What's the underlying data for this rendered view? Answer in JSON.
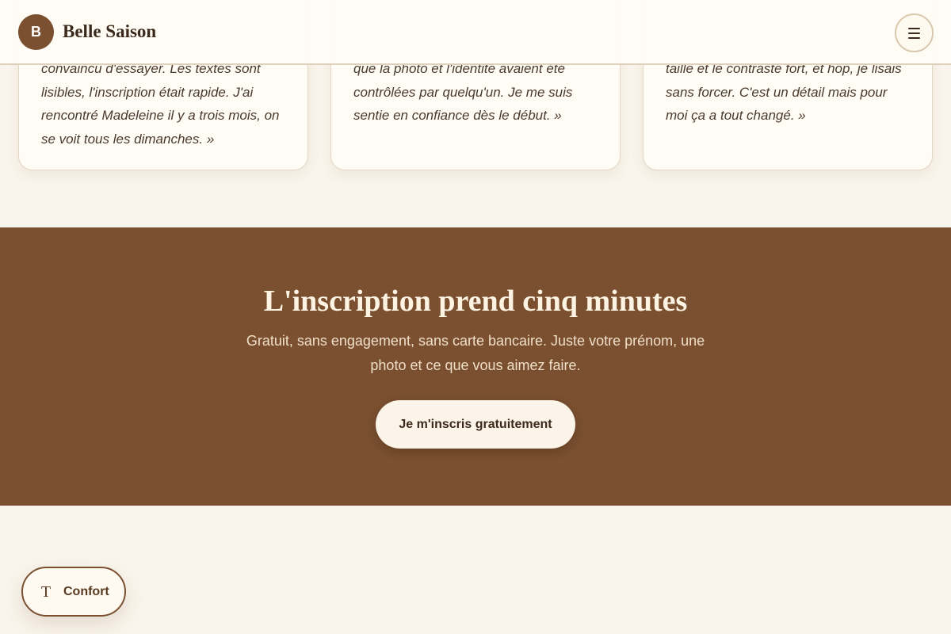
{
  "header": {
    "logo_letter": "B",
    "brand": "Belle Saison",
    "menu_icon": "hamburger-menu-icon"
  },
  "testimonials": [
    {
      "quote": "convaincu d'essayer. Les textes sont lisibles, l'inscription était rapide. J'ai rencontré Madeleine il y a trois mois, on se voit tous les dimanches. »"
    },
    {
      "quote": "que la photo et l'identité avaient été contrôlées par quelqu'un. Je me suis sentie en confiance dès le début. »"
    },
    {
      "quote": "taille et le contraste fort, et hop, je lisais sans forcer. C'est un détail mais pour moi ça a tout changé. »"
    }
  ],
  "cta": {
    "title": "L'inscription prend cinq minutes",
    "text": "Gratuit, sans engagement, sans carte bancaire. Juste votre prénom, une photo et ce que vous aimez faire.",
    "button": "Je m'inscris gratuitement"
  },
  "comfort": {
    "label": "Confort",
    "icon": "text-size-icon",
    "icon_glyph": "T"
  },
  "colors": {
    "accent_brown": "#7a5030",
    "page_background": "#faf5ec",
    "card_background": "#fffcf6"
  }
}
